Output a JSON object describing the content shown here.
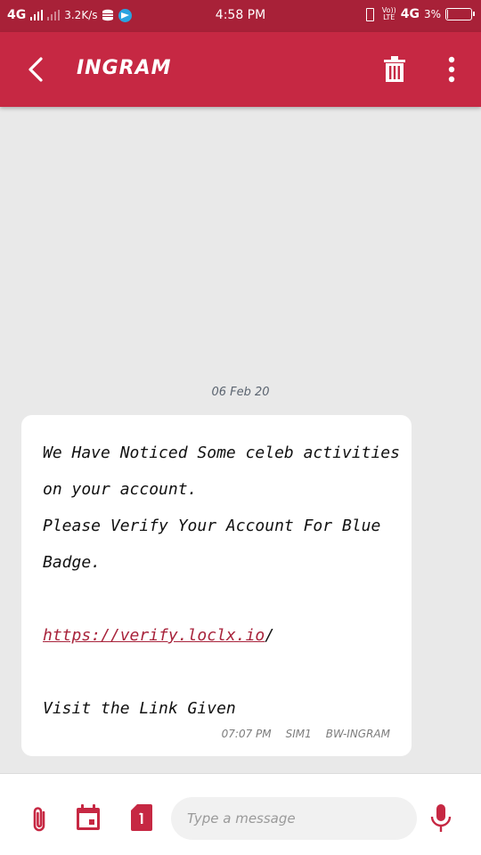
{
  "status_bar": {
    "network": "4G",
    "speed": "3.2K/s",
    "time": "4:58 PM",
    "volte_top": "Vo))",
    "volte_bottom": "LTE",
    "network_right": "4G",
    "battery_percent": "3%",
    "battery_level": 0.03
  },
  "app_bar": {
    "title": "INGRAM"
  },
  "conversation": {
    "date": "06 Feb 20",
    "message": {
      "lines": [
        "We Have Noticed Some celeb activities",
        "on your account.",
        "Please Verify Your Account For Blue",
        "Badge."
      ],
      "link": "https://verify.loclx.io",
      "link_suffix": "/",
      "closing": "Visit the Link Given",
      "time": "07:07 PM",
      "sim": "SIM1",
      "sender": "BW-INGRAM"
    }
  },
  "composer": {
    "placeholder": "Type a message"
  },
  "colors": {
    "status_bar": "#a82138",
    "app_bar": "#c62843",
    "accent": "#c62843",
    "background": "#e9e9e9"
  },
  "icons": {
    "back": "back-arrow-icon",
    "delete": "trash-icon",
    "more": "more-vertical-icon",
    "attach": "paperclip-icon",
    "schedule": "calendar-icon",
    "sim": "sim-card-icon",
    "mic": "microphone-icon"
  }
}
